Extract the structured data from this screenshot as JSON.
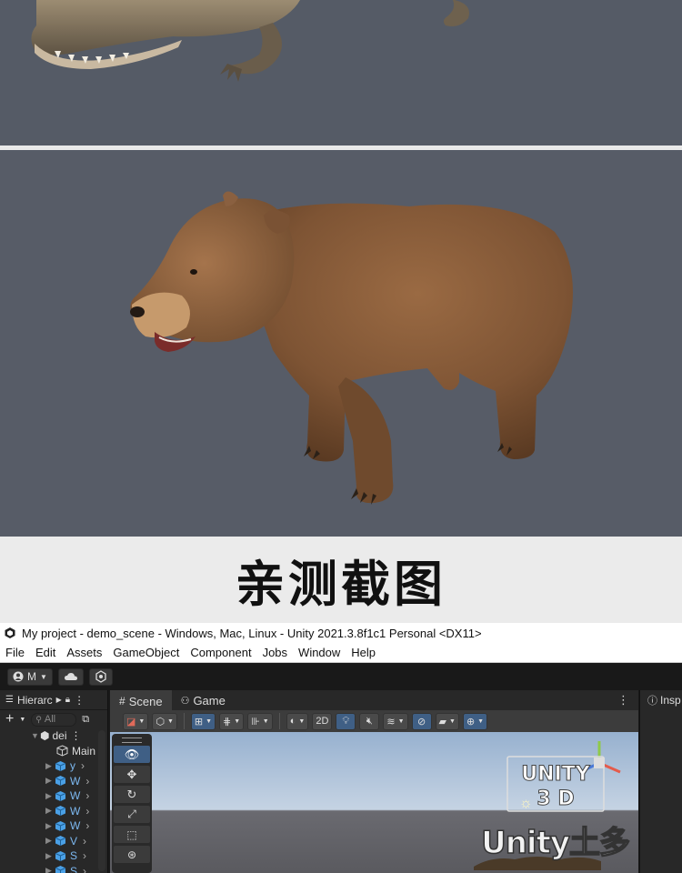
{
  "caption": "亲测截图",
  "window": {
    "title": "My project - demo_scene - Windows, Mac, Linux - Unity 2021.3.8f1c1 Personal <DX11>"
  },
  "menu": [
    "File",
    "Edit",
    "Assets",
    "GameObject",
    "Component",
    "Jobs",
    "Window",
    "Help"
  ],
  "toolbar": {
    "account_label": "M"
  },
  "hierarchy": {
    "tab_label": "Hierarc",
    "search_placeholder": "All",
    "scene_name": "dei",
    "main_item": "Main",
    "items": [
      "y",
      "W",
      "W",
      "W",
      "W",
      "V",
      "S",
      "S"
    ]
  },
  "scene_view": {
    "tabs": [
      "Scene",
      "Game"
    ],
    "toggle_2d": "2D"
  },
  "inspector": {
    "tab_label": "Insp"
  },
  "watermark": {
    "logo_text": "UNITY 3D",
    "brand_text": "Unity土多"
  },
  "colors": {
    "accent_blue": "#3f5f85",
    "editor_bg": "#282828",
    "render_bg": "#555b66"
  }
}
